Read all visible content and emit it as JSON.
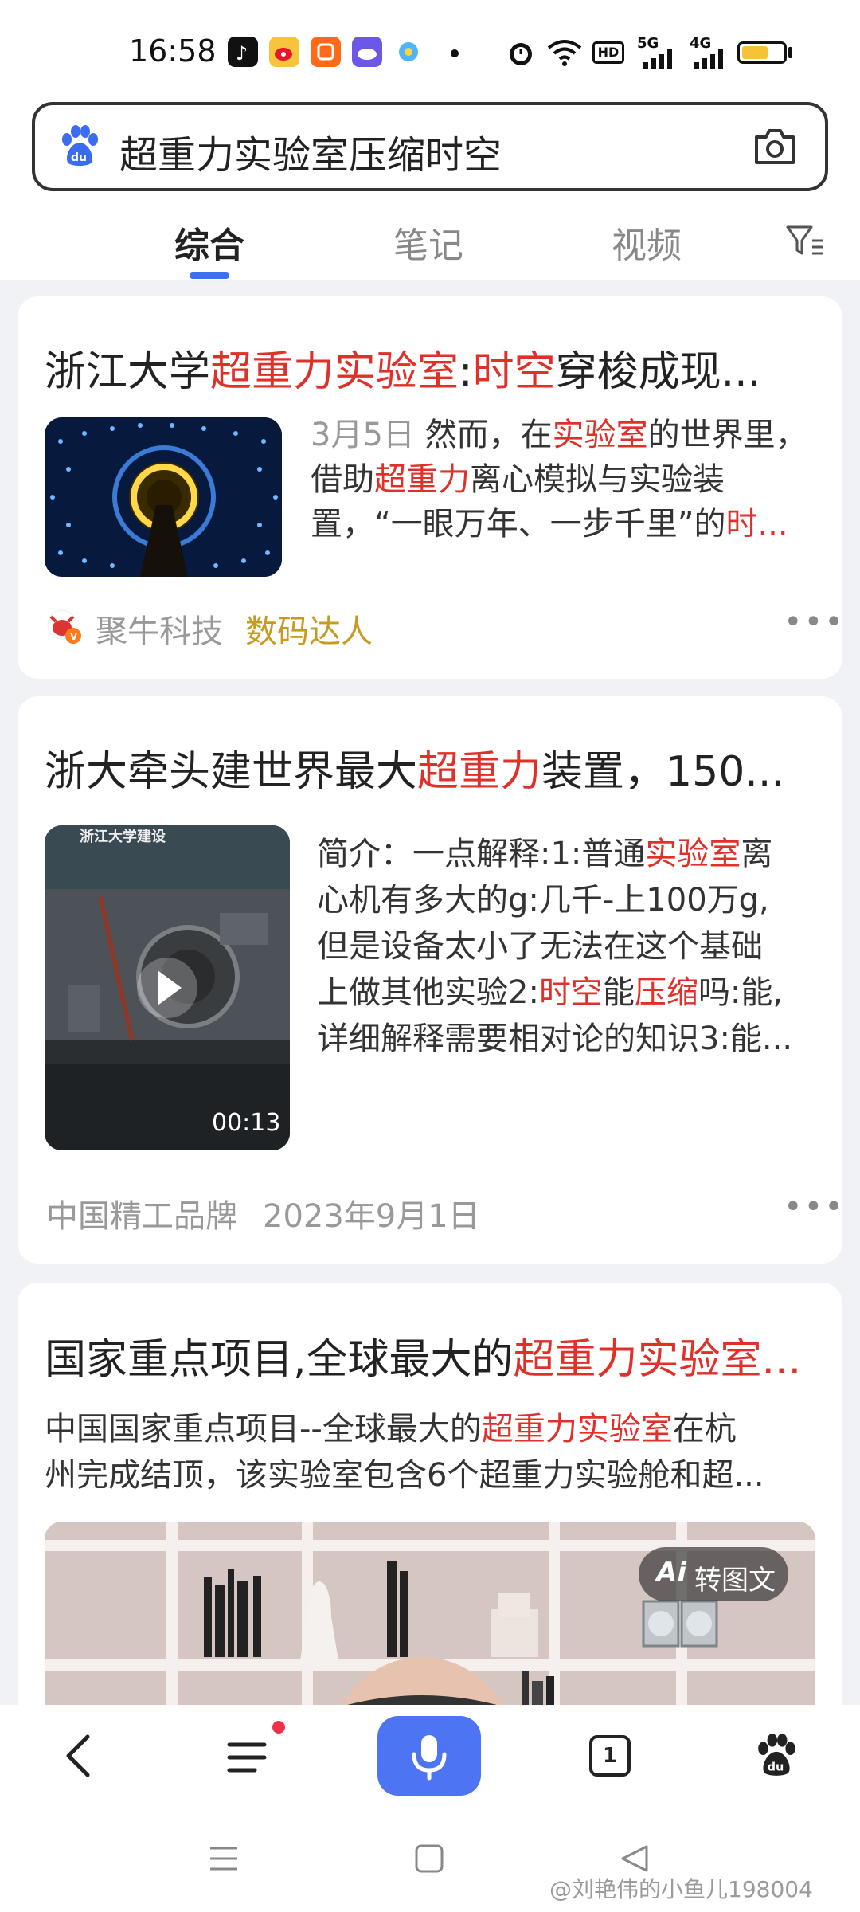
{
  "status_bar": {
    "time": "16:58",
    "app_icons": [
      "douyin-icon",
      "weibo-icon",
      "kuaishou-icon",
      "cloud-icon",
      "pinwheel-icon"
    ],
    "network_label": "HD",
    "signal_1": "5G",
    "signal_2": "4G"
  },
  "search": {
    "query": "超重力实验室压缩时空"
  },
  "tabs": [
    {
      "label": "综合"
    },
    {
      "label": "笔记"
    },
    {
      "label": "视频"
    }
  ],
  "results": [
    {
      "title_prefix": "浙江大学",
      "title_red1": "超重力实验室",
      "title_mid": ":",
      "title_red2": "时空",
      "title_suffix": "穿梭成现...",
      "date": "3月5日",
      "snippet_a": " 然而，在",
      "snippet_red1": "实验室",
      "snippet_b": "的世界里，借助",
      "snippet_red2": "超重力",
      "snippet_c": "离心模拟与实验装置，“一眼万年、一步千里”的",
      "snippet_red3": "时...",
      "source_name": "聚牛科技",
      "source_badge": "数码达人"
    },
    {
      "title_prefix": "浙大牵头建世界最大",
      "title_red1": "超重力",
      "title_suffix": "装置，150...",
      "thumb_caption": "浙江大学建设",
      "duration": "00:13",
      "s1": "简介：一点解释:1:普通",
      "s1_red": "实验室",
      "s1_end": "离",
      "s2": "心机有多大的g:几千-上100万g,",
      "s3": "但是设备太小了无法在这个基础",
      "s4a": "上做其他实验2:",
      "s4_red1": "时空",
      "s4b": "能",
      "s4_red2": "压缩",
      "s4c": "吗:能,",
      "s5": "详细解释需要相对论的知识3:能...",
      "source_name": "中国精工品牌",
      "date": "2023年9月1日"
    },
    {
      "title_prefix": "国家重点项目,全球最大的",
      "title_red1": "超重力实验室...",
      "l1a": "中国国家重点项目--全球最大的",
      "l1_red": "超重力实验室",
      "l1b": "在杭",
      "l2": "州完成结顶，该实验室包含6个超重力实验舱和超...",
      "ai_badge": "转图文"
    }
  ],
  "bottom_nav": {
    "tab_count": "1"
  },
  "watermark": "@刘艳伟的小鱼儿198004",
  "colors": {
    "accent": "#3d6ff0",
    "highlight": "#e0302a",
    "badge_gold": "#c79a22"
  }
}
